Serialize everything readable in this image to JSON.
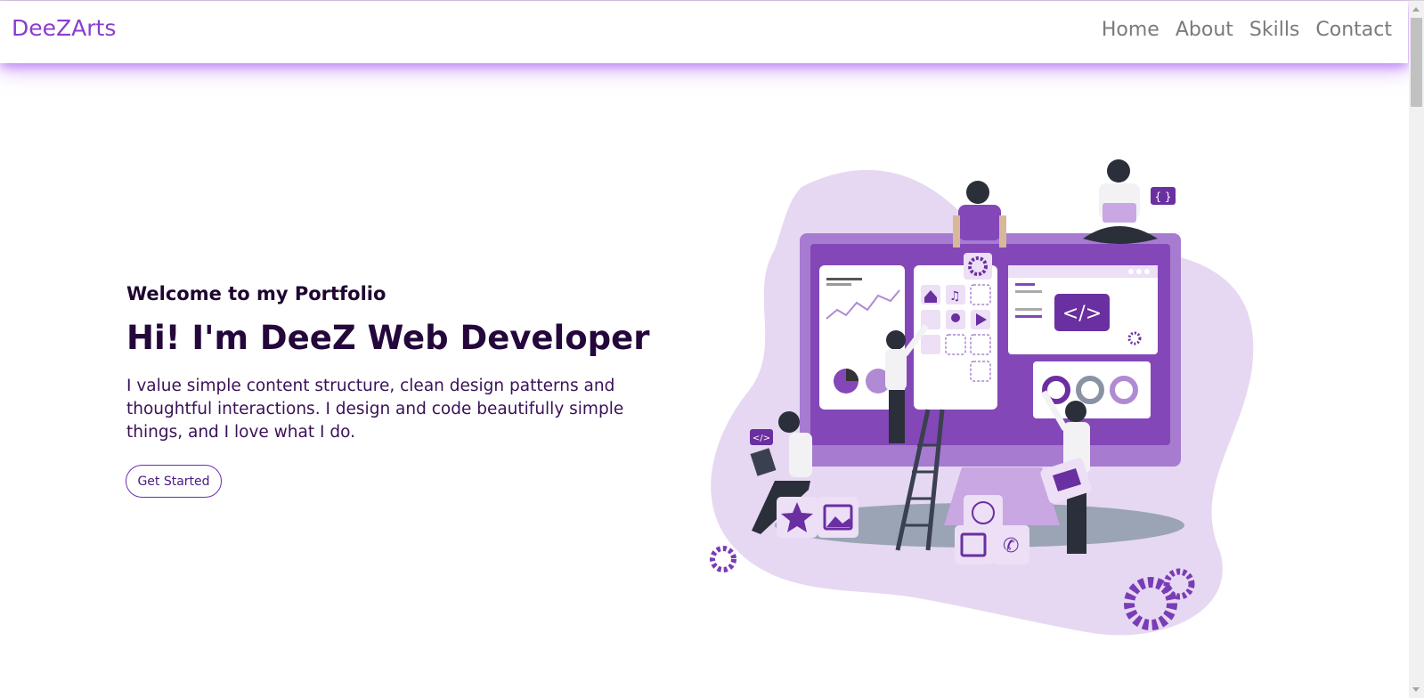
{
  "brand": {
    "name": "DeeZArts"
  },
  "nav": {
    "items": [
      "Home",
      "About",
      "Skills",
      "Contact"
    ]
  },
  "hero": {
    "subtitle": "Welcome to my Portfolio",
    "headline": "Hi! I'm DeeZ Web Developer",
    "intro": "I value simple content structure, clean design patterns and thoughtful interactions. I design and code beautifully simple things, and I love what I do.",
    "cta_label": "Get Started"
  },
  "illustration": {
    "code_tag": "</>",
    "braces_tag": "{ }",
    "code_badge": "</>"
  },
  "colors": {
    "brand": "#8a3ccf",
    "heading": "#24073b",
    "accent": "#6b2fb3",
    "blob": "#e3d5f0",
    "monitor": "#9a66c8"
  }
}
